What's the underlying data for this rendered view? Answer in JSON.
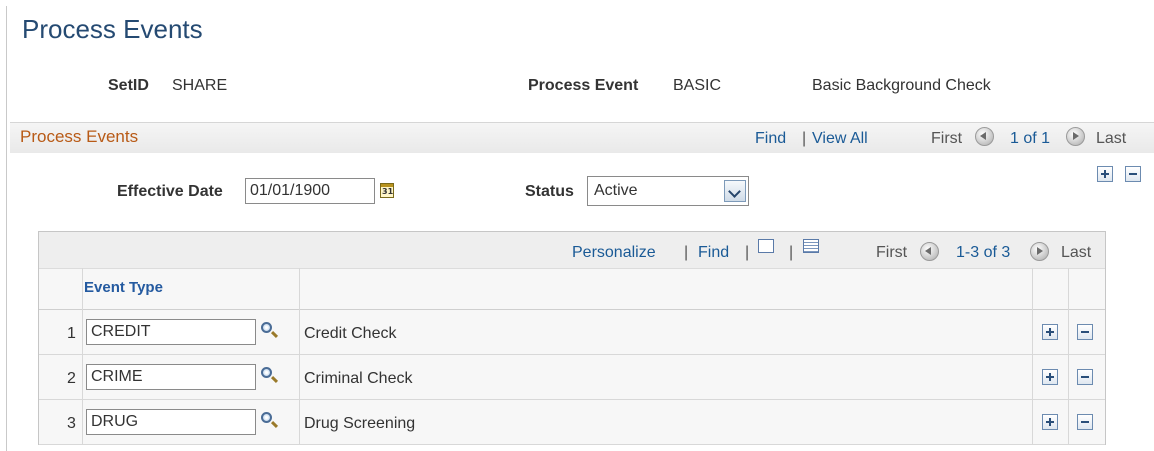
{
  "page": {
    "title": "Process Events"
  },
  "header": {
    "setid_label": "SetID",
    "setid_value": "SHARE",
    "process_event_label": "Process Event",
    "process_event_value": "BASIC",
    "process_event_desc": "Basic Background Check"
  },
  "section": {
    "title": "Process Events",
    "find": "Find",
    "separator": "|",
    "view_all": "View All",
    "first": "First",
    "range": "1 of 1",
    "last": "Last"
  },
  "form": {
    "effective_date_label": "Effective Date",
    "effective_date_value": "01/01/1900",
    "status_label": "Status",
    "status_value": "Active"
  },
  "grid": {
    "personalize": "Personalize",
    "find": "Find",
    "separator": "|",
    "first": "First",
    "range": "1-3 of 3",
    "last": "Last",
    "column_event_type": "Event Type",
    "rows": [
      {
        "num": "1",
        "code": "CREDIT",
        "desc": "Credit Check"
      },
      {
        "num": "2",
        "code": "CRIME",
        "desc": "Criminal Check"
      },
      {
        "num": "3",
        "code": "DRUG",
        "desc": "Drug Screening"
      }
    ]
  },
  "icons": {
    "prev": "nav-prev-icon",
    "next": "nav-next-icon",
    "add": "plus-icon",
    "delete": "minus-icon",
    "lookup": "magnifier-icon",
    "calendar": "calendar-icon",
    "zoom": "new-window-icon",
    "download": "spreadsheet-icon"
  }
}
